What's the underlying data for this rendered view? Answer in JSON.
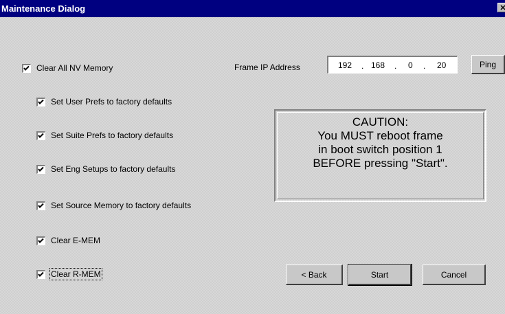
{
  "dialog": {
    "title": "Maintenance Dialog",
    "close_glyph": "✕"
  },
  "checkboxes": [
    {
      "label": "Clear All NV Memory",
      "checked": true
    },
    {
      "label": "Set User Prefs to factory defaults",
      "checked": true
    },
    {
      "label": "Set Suite Prefs to factory defaults",
      "checked": true
    },
    {
      "label": "Set Eng Setups to factory defaults",
      "checked": true
    },
    {
      "label": "Set Source Memory to factory defaults",
      "checked": true
    },
    {
      "label": "Clear E-MEM",
      "checked": true
    },
    {
      "label": "Clear R-MEM",
      "checked": true
    }
  ],
  "frame_ip": {
    "label": "Frame IP Address",
    "octets": [
      "192",
      "168",
      "0",
      "20"
    ],
    "separator": "."
  },
  "buttons": {
    "ping": "Ping",
    "back": "< Back",
    "start": "Start",
    "cancel": "Cancel"
  },
  "caution": {
    "lines": [
      "CAUTION:",
      "You MUST reboot frame",
      "in boot switch position 1",
      "BEFORE pressing \"Start\"."
    ]
  },
  "colors": {
    "titlebar": "#000080",
    "face": "#c0c0c0"
  }
}
